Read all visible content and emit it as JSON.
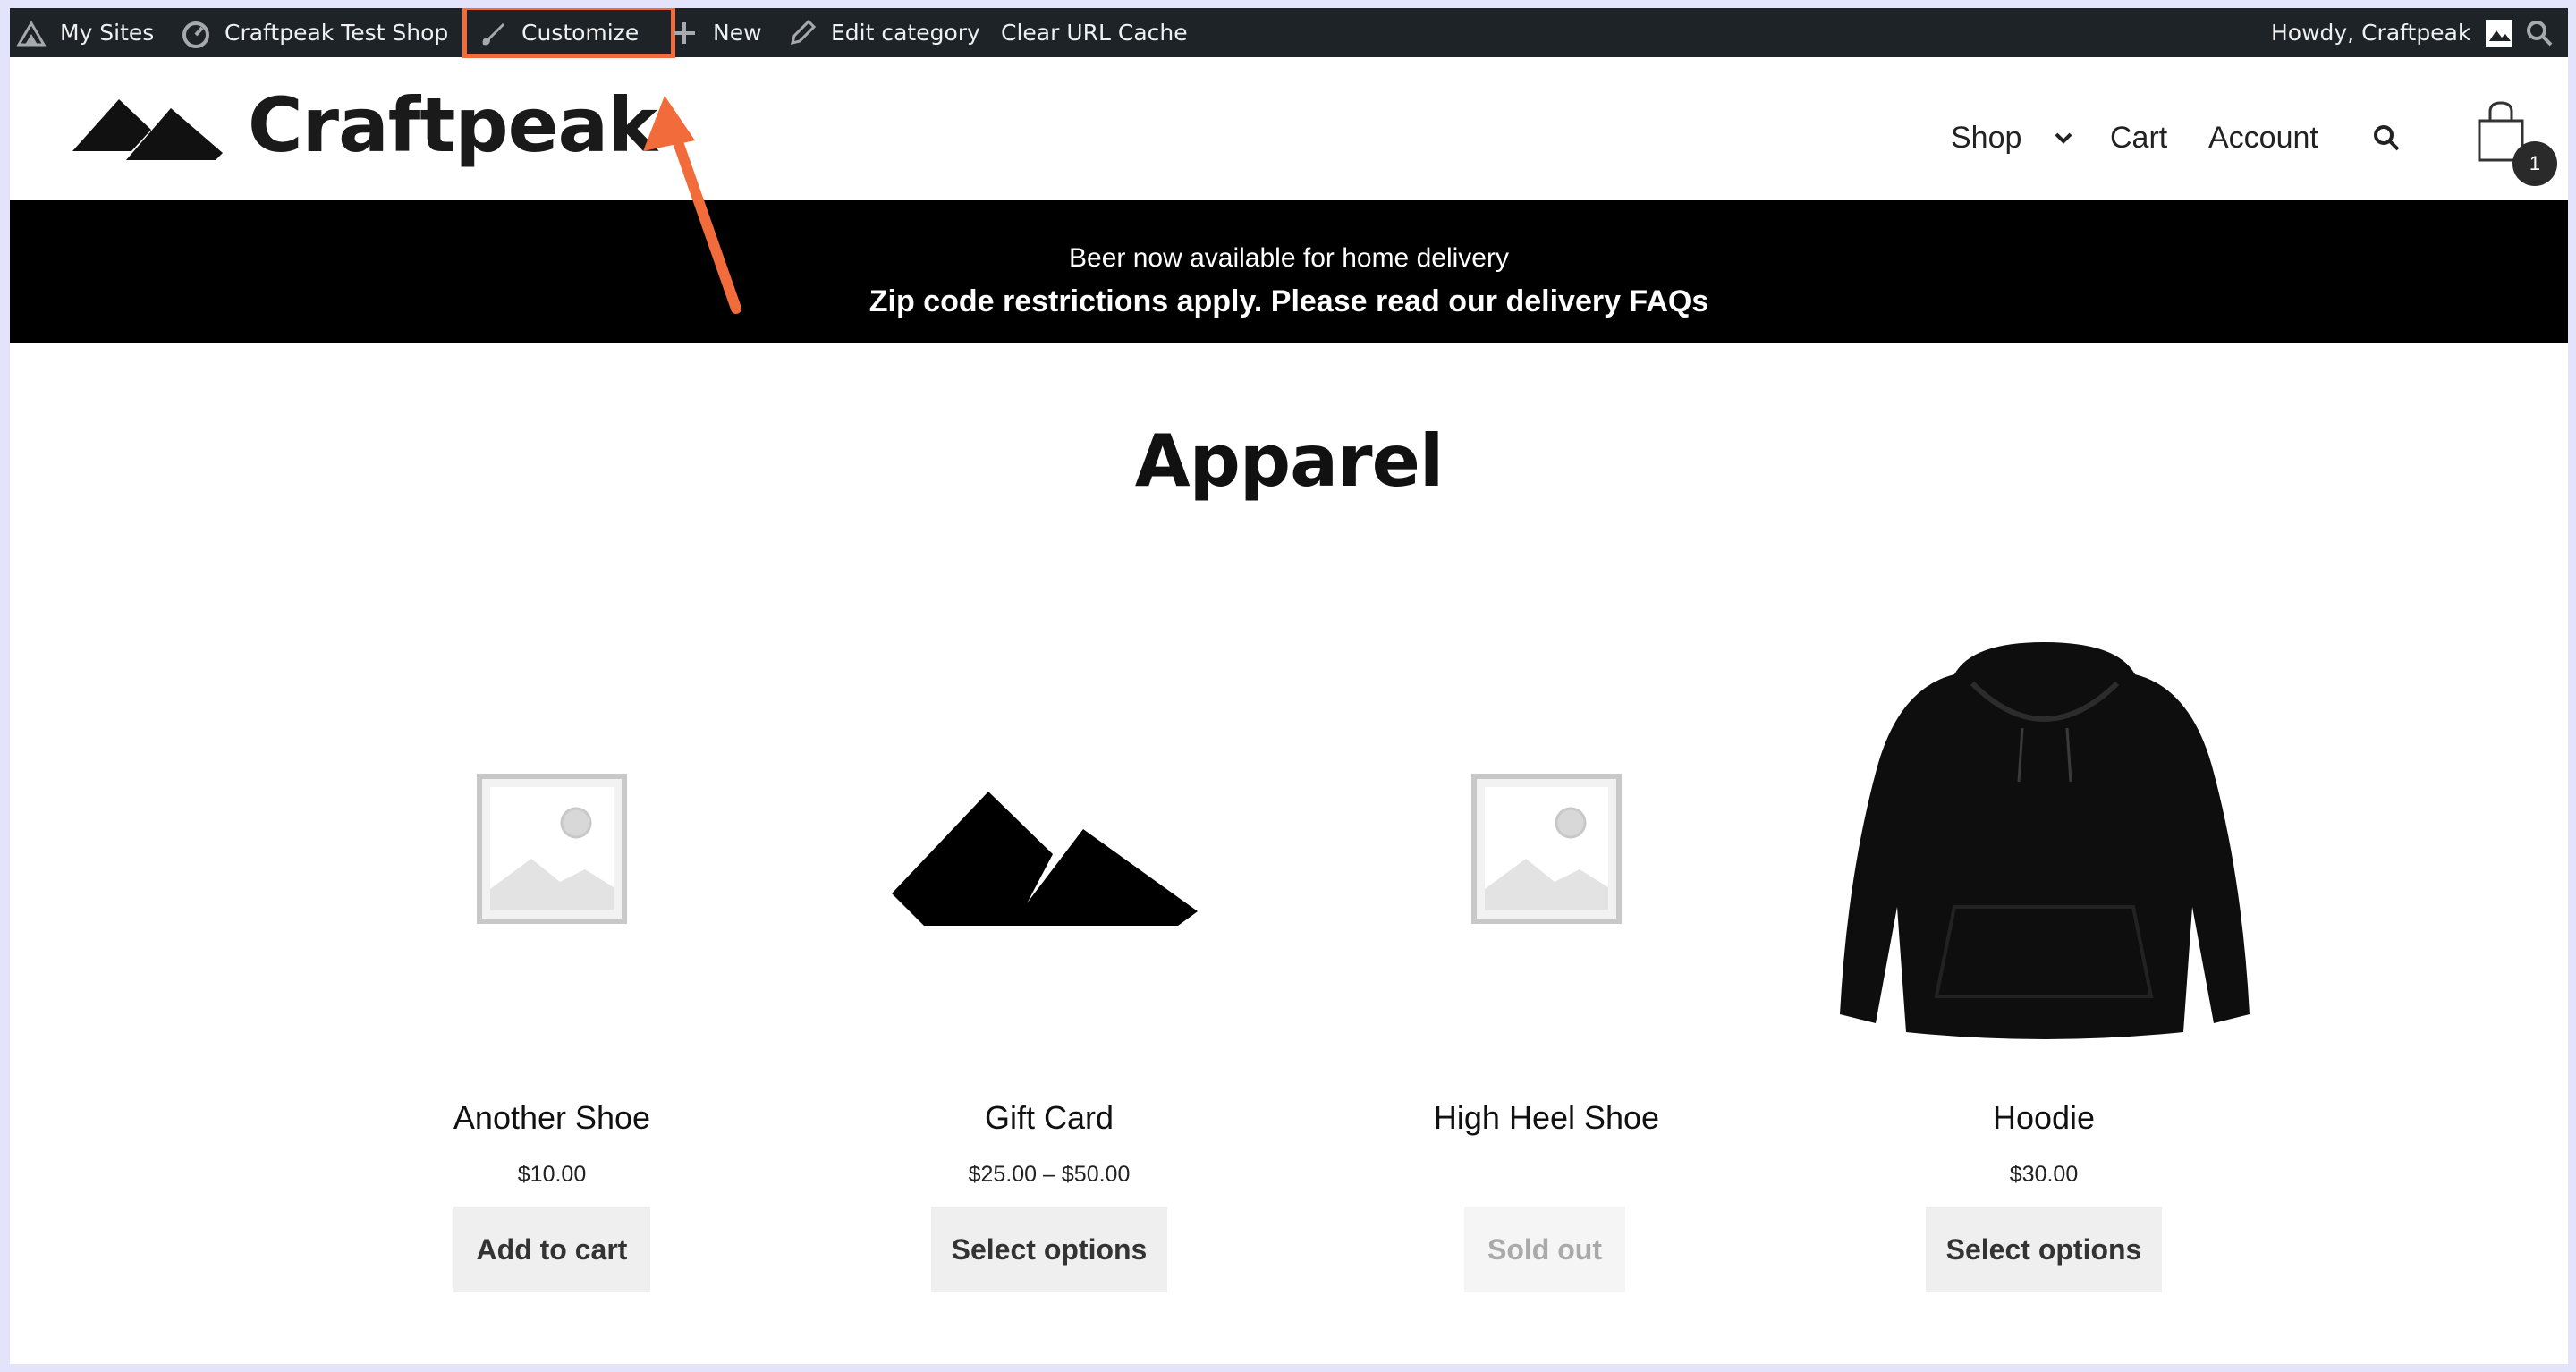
{
  "admin_bar": {
    "my_sites": "My Sites",
    "site_name": "Craftpeak Test Shop",
    "customize": "Customize",
    "new": "New",
    "edit_category": "Edit category",
    "clear_cache": "Clear URL Cache",
    "greeting": "Howdy, Craftpeak"
  },
  "header": {
    "logo_text": "Craftpeak",
    "nav": {
      "shop": "Shop",
      "cart": "Cart",
      "account": "Account"
    },
    "cart_count": "1"
  },
  "banner": {
    "line1": "Beer now available for home delivery",
    "line2": "Zip code restrictions apply. Please read our delivery FAQs"
  },
  "page": {
    "title": "Apparel"
  },
  "products": [
    {
      "name": "Another Shoe",
      "price": "$10.00",
      "button": "Add to cart",
      "image": "placeholder-image"
    },
    {
      "name": "Gift Card",
      "price": "$25.00 – $50.00",
      "button": "Select options",
      "image": "craftpeak-logo-mark"
    },
    {
      "name": "High Heel Shoe",
      "price": "",
      "button": "Sold out",
      "image": "placeholder-image"
    },
    {
      "name": "Hoodie",
      "price": "$30.00",
      "button": "Select options",
      "image": "black-hoodie"
    }
  ],
  "colors": {
    "admin_bar_bg": "#1d2327",
    "highlight": "#f26b3a",
    "banner_bg": "#000000",
    "button_bg": "#efefef"
  }
}
